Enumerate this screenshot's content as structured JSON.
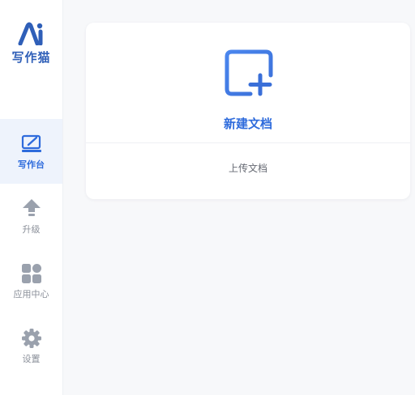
{
  "brand": {
    "logo_text": "写作猫",
    "color": "#2f5fb8"
  },
  "sidebar": {
    "items": [
      {
        "label": "写作台",
        "icon": "edit-board-icon",
        "active": true
      },
      {
        "label": "升级",
        "icon": "arrow-up-icon",
        "active": false
      },
      {
        "label": "应用中心",
        "icon": "app-grid-icon",
        "active": false
      },
      {
        "label": "设置",
        "icon": "gear-icon",
        "active": false
      }
    ]
  },
  "main": {
    "new_document_label": "新建文档",
    "new_document_icon": "new-document-icon",
    "upload_document_label": "上传文档"
  },
  "colors": {
    "accent": "#2e6bdc",
    "sidebar_active_bg": "#eef3fc",
    "inactive_icon": "#9aa1ad",
    "page_bg": "#f7f8fa"
  }
}
